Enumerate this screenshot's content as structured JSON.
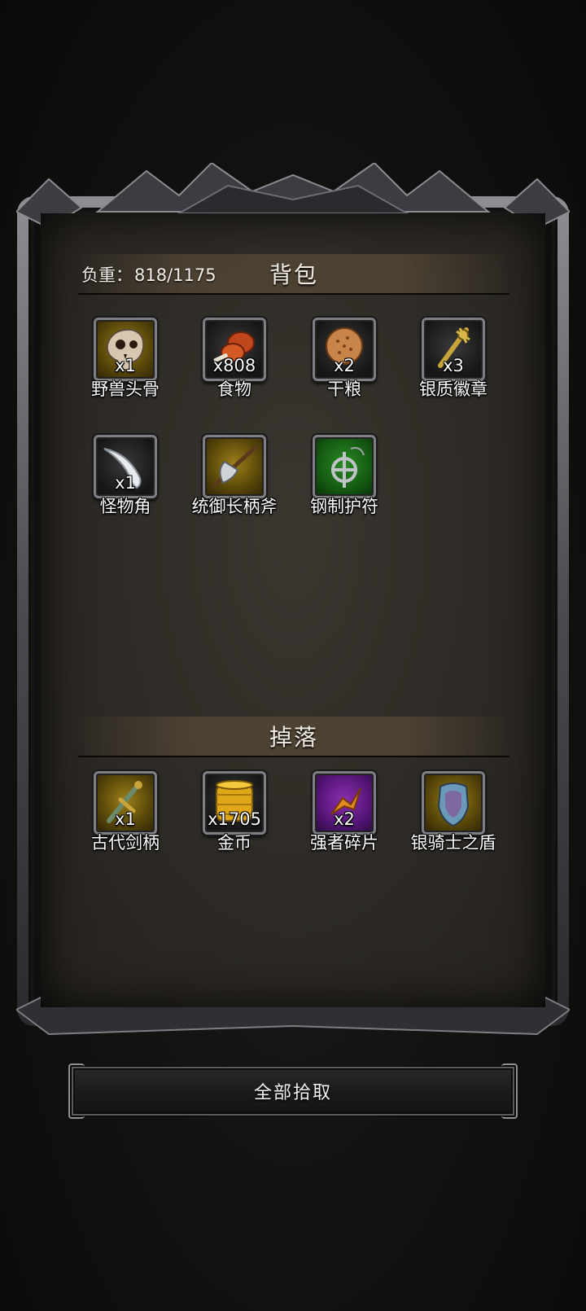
{
  "backpack": {
    "weight_label": "负重：",
    "weight_value": "818/1175",
    "title": "背包",
    "items": [
      {
        "name": "野兽头骨",
        "count": "x1",
        "rarity": "gold",
        "icon": "beast-skull-icon"
      },
      {
        "name": "食物",
        "count": "x808",
        "rarity": "common",
        "icon": "meat-icon"
      },
      {
        "name": "干粮",
        "count": "x2",
        "rarity": "common",
        "icon": "biscuit-icon"
      },
      {
        "name": "银质徽章",
        "count": "x3",
        "rarity": "common",
        "icon": "silver-badge-icon"
      },
      {
        "name": "怪物角",
        "count": "x1",
        "rarity": "common",
        "icon": "monster-horn-icon"
      },
      {
        "name": "统御长柄斧",
        "count": "",
        "rarity": "gold",
        "icon": "halberd-icon"
      },
      {
        "name": "钢制护符",
        "count": "",
        "rarity": "green",
        "icon": "steel-amulet-icon"
      }
    ]
  },
  "drops": {
    "title": "掉落",
    "items": [
      {
        "name": "古代剑柄",
        "count": "x1",
        "rarity": "gold",
        "icon": "sword-hilt-icon"
      },
      {
        "name": "金币",
        "count": "x1705",
        "rarity": "common",
        "icon": "gold-coins-icon"
      },
      {
        "name": "强者碎片",
        "count": "x2",
        "rarity": "purple",
        "icon": "shard-icon"
      },
      {
        "name": "银骑士之盾",
        "count": "",
        "rarity": "gold",
        "icon": "knight-shield-icon"
      }
    ]
  },
  "actions": {
    "pickup_all_label": "全部拾取"
  },
  "colors": {
    "gold_slot": "#9c7f19",
    "green_slot": "#2b8a24",
    "purple_slot": "#8a2fb0",
    "common_slot": "#2a2a2a"
  }
}
